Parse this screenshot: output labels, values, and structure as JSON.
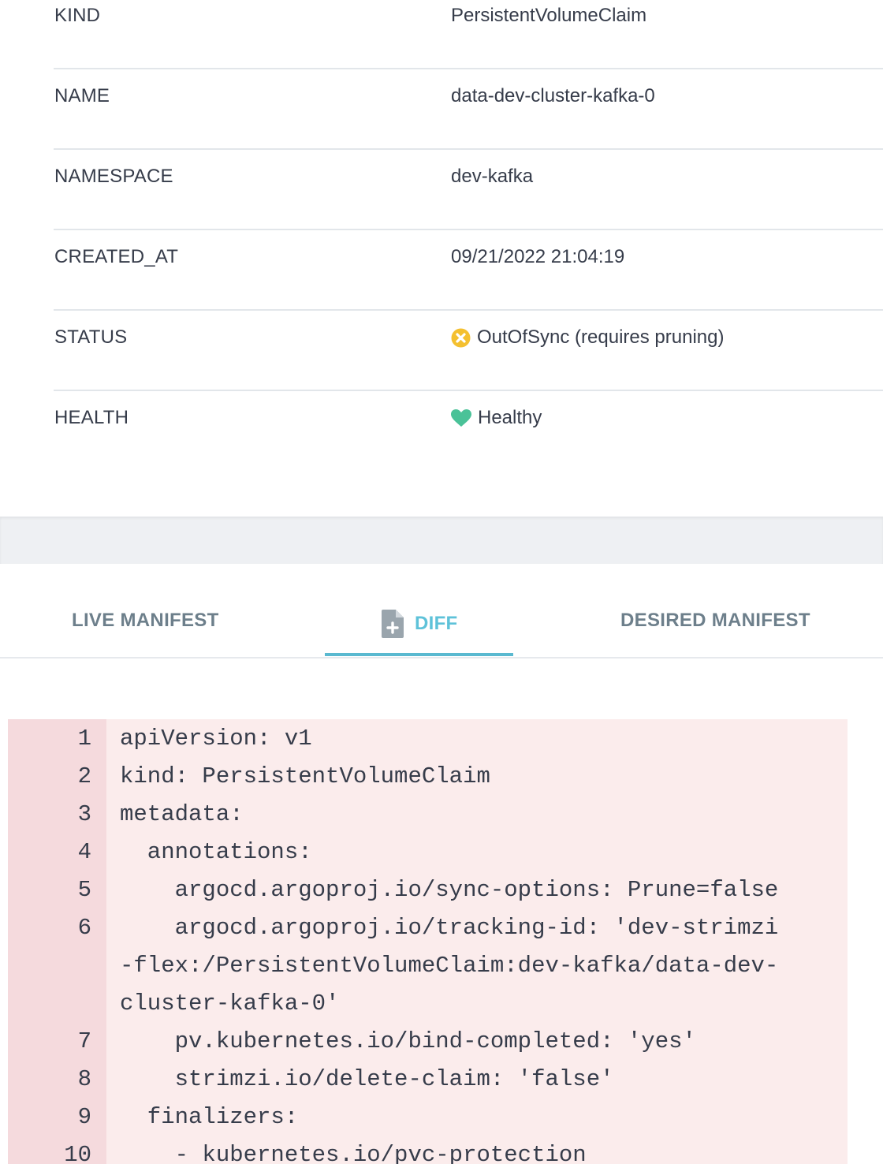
{
  "summary": {
    "rows": [
      {
        "key": "KIND",
        "value": "PersistentVolumeClaim"
      },
      {
        "key": "NAME",
        "value": "data-dev-cluster-kafka-0"
      },
      {
        "key": "NAMESPACE",
        "value": "dev-kafka"
      },
      {
        "key": "CREATED_AT",
        "value": "09/21/2022 21:04:19"
      },
      {
        "key": "STATUS",
        "value": "OutOfSync (requires pruning)",
        "icon": "out-of-sync-icon",
        "icon_color": "#f4c030"
      },
      {
        "key": "HEALTH",
        "value": "Healthy",
        "icon": "heart-icon",
        "icon_color": "#4ac298"
      }
    ]
  },
  "tabs": {
    "items": [
      {
        "label": "LIVE MANIFEST"
      },
      {
        "label": "DIFF",
        "icon": "file-plus-icon",
        "active": true
      },
      {
        "label": "DESIRED MANIFEST"
      }
    ],
    "active_color": "#5ec2d9"
  },
  "code": {
    "lines": [
      {
        "n": "1",
        "text": "apiVersion: v1"
      },
      {
        "n": "2",
        "text": "kind: PersistentVolumeClaim"
      },
      {
        "n": "3",
        "text": "metadata:"
      },
      {
        "n": "4",
        "text": "  annotations:"
      },
      {
        "n": "5",
        "text": "    argocd.argoproj.io/sync-options: Prune=false"
      },
      {
        "n": "6",
        "text": "    argocd.argoproj.io/tracking-id: 'dev-strimzi"
      },
      {
        "n": "",
        "text": "-flex:/PersistentVolumeClaim:dev-kafka/data-dev-"
      },
      {
        "n": "",
        "text": "cluster-kafka-0'"
      },
      {
        "n": "7",
        "text": "    pv.kubernetes.io/bind-completed: 'yes'"
      },
      {
        "n": "8",
        "text": "    strimzi.io/delete-claim: 'false'"
      },
      {
        "n": "9",
        "text": "  finalizers:"
      },
      {
        "n": "10",
        "text": "    - kubernetes.io/pvc-protection"
      }
    ],
    "background": "#fbecec",
    "gutter_background": "#f5dadd"
  }
}
